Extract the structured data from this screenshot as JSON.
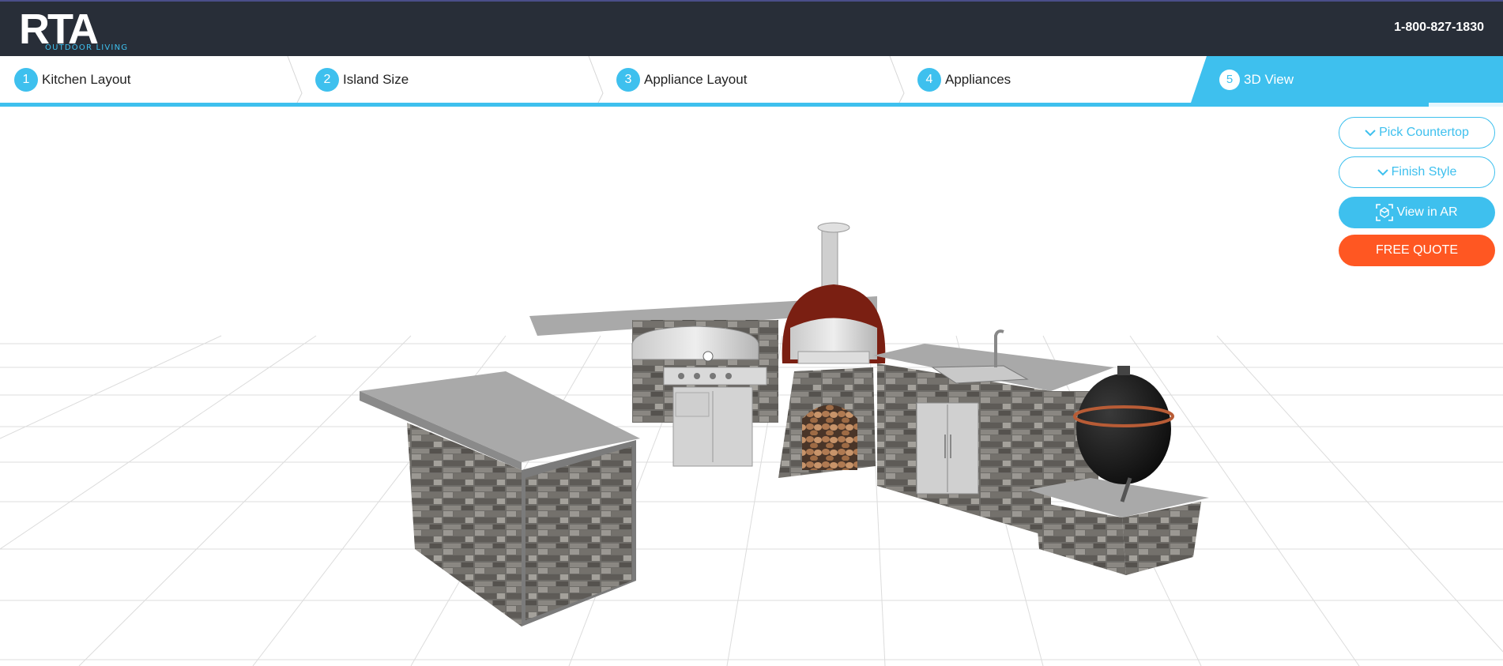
{
  "header": {
    "logo_text": "RTA",
    "logo_subtitle": "OUTDOOR LIVING",
    "phone": "1-800-827-1830"
  },
  "steps": [
    {
      "number": "1",
      "label": "Kitchen Layout",
      "active": false
    },
    {
      "number": "2",
      "label": "Island Size",
      "active": false
    },
    {
      "number": "3",
      "label": "Appliance Layout",
      "active": false
    },
    {
      "number": "4",
      "label": "Appliances",
      "active": false
    },
    {
      "number": "5",
      "label": "3D View",
      "active": true
    }
  ],
  "controls": {
    "pick_countertop": "Pick Countertop",
    "finish_style": "Finish Style",
    "view_in_ar": "View in AR",
    "free_quote": "FREE QUOTE"
  },
  "colors": {
    "header_bg": "#282e38",
    "accent": "#3ec0ee",
    "quote": "#ff5722"
  },
  "icons": {
    "dropdown": "chevron-down-icon",
    "ar": "ar-cube-icon"
  }
}
